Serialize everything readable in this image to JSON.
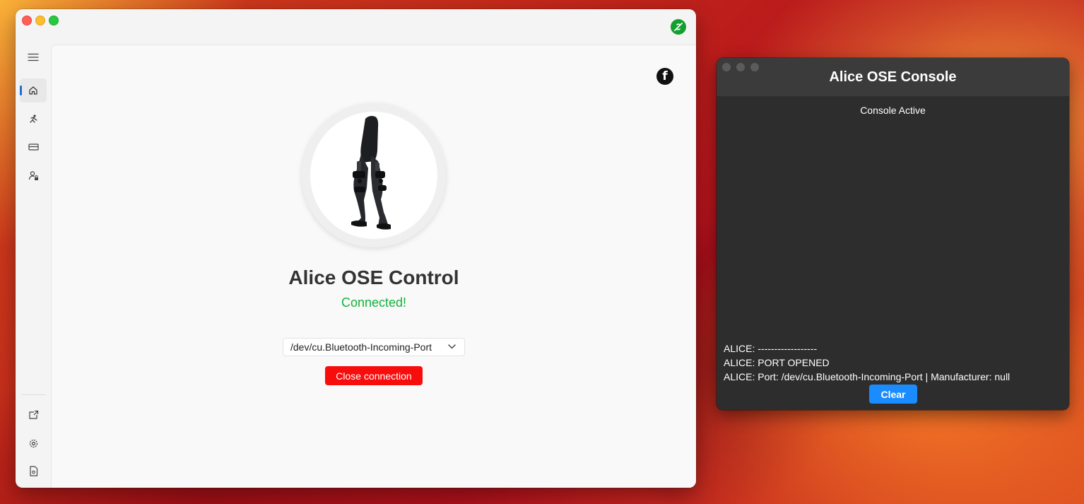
{
  "main_window": {
    "sidebar": {
      "top_items": [
        {
          "name": "menu"
        },
        {
          "name": "home",
          "active": true
        },
        {
          "name": "exoskeleton"
        },
        {
          "name": "card"
        },
        {
          "name": "user-lock"
        }
      ],
      "bottom_items": [
        {
          "name": "export"
        },
        {
          "name": "settings"
        },
        {
          "name": "document"
        }
      ]
    },
    "app_title": "Alice OSE Control",
    "status": "Connected!",
    "port_select": {
      "selected": "/dev/cu.Bluetooth-Incoming-Port"
    },
    "close_button": "Close connection",
    "colors": {
      "connected": "#14b33a",
      "close_button": "#f80d0d",
      "accent": "#1f6fd1"
    }
  },
  "console_window": {
    "title": "Alice OSE Console",
    "status": "Console Active",
    "log": [
      "ALICE: ------------------",
      "ALICE: PORT OPENED",
      "ALICE: Port: /dev/cu.Bluetooth-Incoming-Port | Manufacturer: null"
    ],
    "clear_button": "Clear",
    "colors": {
      "clear_button": "#1a8cff"
    }
  }
}
